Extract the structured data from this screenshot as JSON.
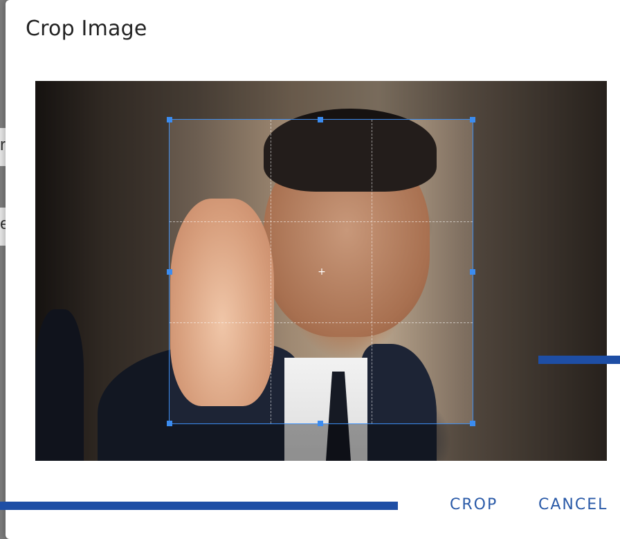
{
  "dialog": {
    "title": "Crop Image"
  },
  "background_fragments": {
    "char1": "r",
    "char2": "e."
  },
  "actions": {
    "crop_label": "CROP",
    "cancel_label": "CANCEL"
  },
  "colors": {
    "accent": "#2a5aa8",
    "crop_frame": "#3b8cf0",
    "bar": "#1e4ea5"
  },
  "icons": {
    "center_mark": "+"
  }
}
